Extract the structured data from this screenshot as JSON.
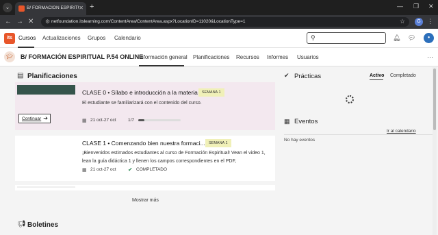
{
  "browser": {
    "tab_title": "B/ FORMACIÓN ESPIRITUAL P.5",
    "tab_close": "✕",
    "new_tab": "+",
    "url": "netfoundation.itslearning.com/ContentArea/ContentArea.aspx?LocationID=11020&LocationType=1",
    "profile_initial": "G"
  },
  "topnav": {
    "logo": "its",
    "items": [
      "Cursos",
      "Actualizaciones",
      "Grupos",
      "Calendario"
    ]
  },
  "course": {
    "title": "B/ FORMACIÓN ESPIRITUAL P.54 ONLINE",
    "tabs": [
      "Información general",
      "Planificaciones",
      "Recursos",
      "Informes",
      "Usuarios"
    ]
  },
  "plans": {
    "heading": "Planificaciones",
    "items": [
      {
        "title": "CLASE 0 • Sílabo e introducción a la materia",
        "badge": "SEMANA 1",
        "description": "El estudiante se familiarizará con el contenido del curso.",
        "dates": "21 oct-27 oct",
        "progress_text": "1/7",
        "progress": 0.14,
        "button": "Continuar"
      },
      {
        "title": "CLASE 1 • Comenzando bien nuestra formaci...",
        "badge": "SEMANA 1",
        "description": "¡Bienvenidos estimados estudiantes al curso de Formación Espiritual! Vean el video 1, lean la guía didáctica 1 y llenen los campos correspondientes en el PDF,",
        "dates": "21 oct-27 oct",
        "status": "COMPLETADO"
      }
    ],
    "show_more": "Mostrar más"
  },
  "bulletins": {
    "heading": "Boletines"
  },
  "practices": {
    "heading": "Prácticas",
    "tabs": [
      "Activo",
      "Completado"
    ]
  },
  "events": {
    "heading": "Eventos",
    "calendar_link": "Ir al calendario",
    "empty": "No hay eventos"
  }
}
